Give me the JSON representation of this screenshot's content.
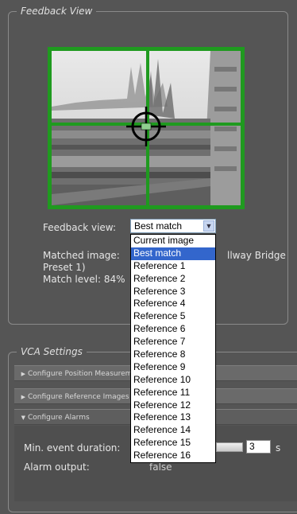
{
  "feedback": {
    "legend": "Feedback View",
    "feedback_view_label": "Feedback view:",
    "feedback_view_value": "Best match",
    "matched_image_label": "Matched image:",
    "matched_image_tail": "llway Bridge",
    "matched_image_line2": "Preset 1)",
    "match_level_label": "Match level: 84%",
    "options": [
      "Current image",
      "Best match",
      "Reference 1",
      "Reference 2",
      "Reference 3",
      "Reference 4",
      "Reference 5",
      "Reference 6",
      "Reference 7",
      "Reference 8",
      "Reference 9",
      "Reference 10",
      "Reference 11",
      "Reference 12",
      "Reference 13",
      "Reference 14",
      "Reference 15",
      "Reference 16"
    ],
    "selected_index": 1
  },
  "vca": {
    "legend": "VCA Settings",
    "sections": [
      "Configure Position Measurement",
      "Configure Reference Images",
      "Configure Alarms"
    ],
    "min_event_duration_label": "Min. event duration:",
    "min_event_duration_value": "3",
    "unit": "s",
    "alarm_output_label": "Alarm output:",
    "alarm_output_value": "false"
  },
  "colors": {
    "frame_green": "#1f9a1f",
    "selection_blue": "#3366cc",
    "panel_bg": "#555555"
  }
}
